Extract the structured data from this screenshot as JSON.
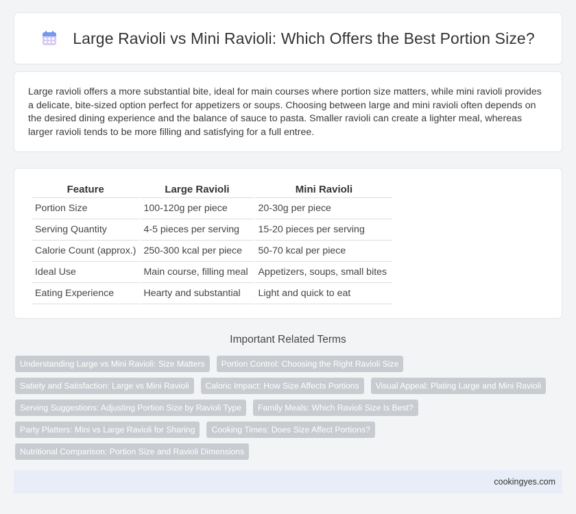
{
  "header": {
    "title": "Large Ravioli vs Mini Ravioli: Which Offers the Best Portion Size?",
    "icon": "calendar-icon"
  },
  "intro": {
    "text": "Large ravioli offers a more substantial bite, ideal for main courses where portion size matters, while mini ravioli provides a delicate, bite-sized option perfect for appetizers or soups. Choosing between large and mini ravioli often depends on the desired dining experience and the balance of sauce to pasta. Smaller ravioli can create a lighter meal, whereas larger ravioli tends to be more filling and satisfying for a full entree."
  },
  "table": {
    "headers": [
      "Feature",
      "Large Ravioli",
      "Mini Ravioli"
    ],
    "rows": [
      [
        "Portion Size",
        "100-120g per piece",
        "20-30g per piece"
      ],
      [
        "Serving Quantity",
        "4-5 pieces per serving",
        "15-20 pieces per serving"
      ],
      [
        "Calorie Count (approx.)",
        "250-300 kcal per piece",
        "50-70 kcal per piece"
      ],
      [
        "Ideal Use",
        "Main course, filling meal",
        "Appetizers, soups, small bites"
      ],
      [
        "Eating Experience",
        "Hearty and substantial",
        "Light and quick to eat"
      ]
    ]
  },
  "related": {
    "title": "Important Related Terms",
    "rows": [
      [
        "Understanding Large vs Mini Ravioli: Size Matters",
        "Portion Control: Choosing the Right Ravioli Size"
      ],
      [
        "Satiety and Satisfaction: Large vs Mini Ravioli",
        "Caloric Impact: How Size Affects Portions",
        "Visual Appeal: Plating Large and Mini Ravioli"
      ],
      [
        "Serving Suggestions: Adjusting Portion Size by Ravioli Type",
        "Family Meals: Which Ravioli Size Is Best?"
      ],
      [
        "Party Platters: Mini vs Large Ravioli for Sharing",
        "Cooking Times: Does Size Affect Portions?"
      ],
      [
        "Nutritional Comparison: Portion Size and Ravioli Dimensions"
      ]
    ]
  },
  "footer": {
    "source": "cookingyes.com"
  },
  "colors": {
    "tag_bg": "#c8ccd1",
    "footer_bg": "#e8edf7",
    "icon_top": "#5b8def",
    "icon_body": "#c9b6f0"
  }
}
